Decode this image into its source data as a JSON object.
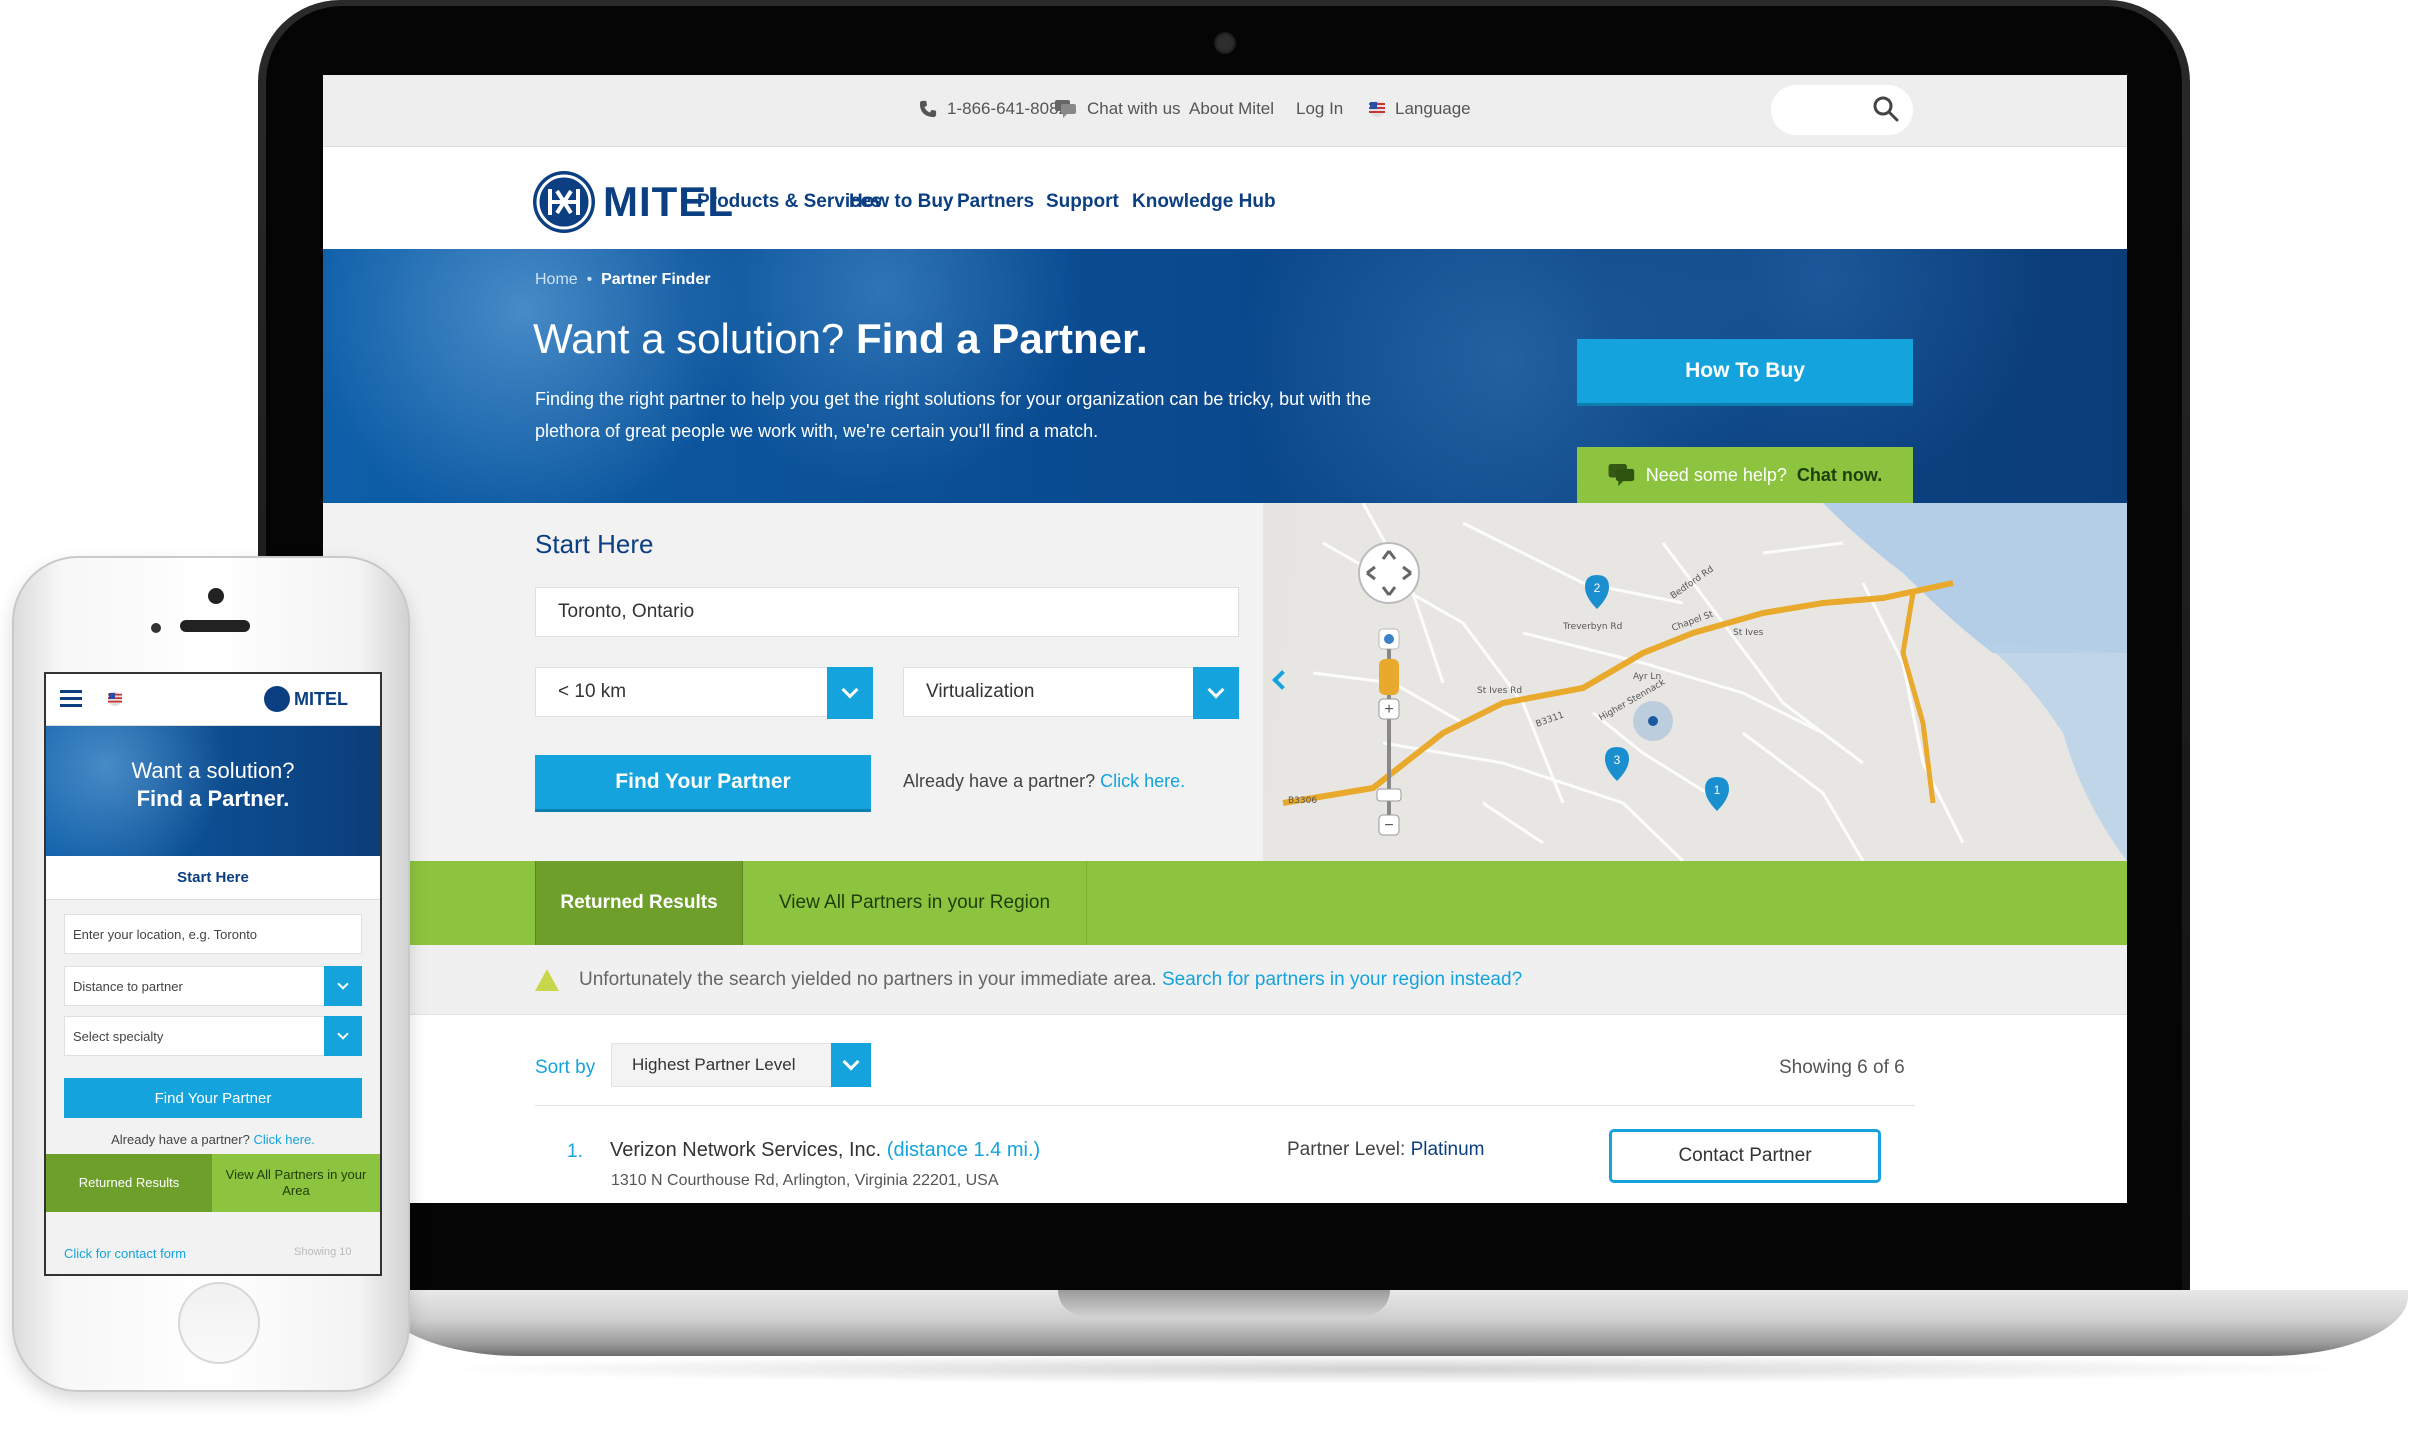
{
  "topbar": {
    "phone": "1-866-641-8082",
    "chat": "Chat with us",
    "about": "About Mitel",
    "login": "Log In",
    "language": "Language"
  },
  "nav": {
    "logo_text": "MITEL",
    "links": [
      "Products & Services",
      "How to Buy",
      "Partners",
      "Support",
      "Knowledge Hub"
    ]
  },
  "hero": {
    "breadcrumb_home": "Home",
    "breadcrumb_sep": "•",
    "breadcrumb_current": "Partner Finder",
    "title_light": "Want a solution?",
    "title_bold": "Find a Partner.",
    "description": "Finding the right partner to help you get the right solutions for your organization can be tricky, but with the plethora of great people we work with, we're certain you'll find a match.",
    "how_to_buy": "How To Buy",
    "help_prefix": "Need some help?",
    "help_link": "Chat now."
  },
  "search": {
    "title": "Start Here",
    "location": "Toronto, Ontario",
    "distance": "< 10 km",
    "specialty": "Virtualization",
    "find_button": "Find Your Partner",
    "already_text": "Already have a partner?",
    "already_link": "Click here."
  },
  "map": {
    "markers": [
      "2",
      "3",
      "1"
    ],
    "labels": [
      "St Ives",
      "St Ives Rd",
      "B3306",
      "B3311",
      "Chapel St",
      "Treverbyn Rd",
      "Bedford Rd",
      "Higher Stennack",
      "Ayr Ln"
    ]
  },
  "tabs": {
    "returned": "Returned Results",
    "view_all": "View All Partners in your Region"
  },
  "notice": {
    "message": "Unfortunately the search yielded no partners in your immediate area.",
    "link": "Search for partners in your region instead?"
  },
  "results": {
    "sort_label": "Sort by",
    "sort_value": "Highest Partner Level",
    "showing": "Showing 6 of 6",
    "items": [
      {
        "number": "1.",
        "name": "Verizon Network Services, Inc.",
        "distance": "(distance 1.4 mi.)",
        "address": "1310 N Courthouse Rd, Arlington, Virginia 22201, USA",
        "level_label": "Partner Level:",
        "level": "Platinum",
        "contact_button": "Contact Partner"
      }
    ]
  },
  "phone": {
    "logo_text": "MITEL",
    "hero_line1": "Want a solution?",
    "hero_line2": "Find a Partner.",
    "start": "Start Here",
    "location_placeholder": "Enter your location, e.g. Toronto",
    "distance_placeholder": "Distance to partner",
    "specialty_placeholder": "Select specialty",
    "find_button": "Find Your Partner",
    "already_text": "Already have a partner?",
    "already_link": "Click here.",
    "tab_returned": "Returned Results",
    "tab_view_all": "View All Partners in your Area",
    "footer_link": "Click for contact form",
    "footer_showing": "Showing 10"
  },
  "colors": {
    "brand_navy": "#0b3f82",
    "accent_blue": "#14a3dc",
    "accent_green": "#8cc43f",
    "active_green": "#6e9f2b"
  }
}
